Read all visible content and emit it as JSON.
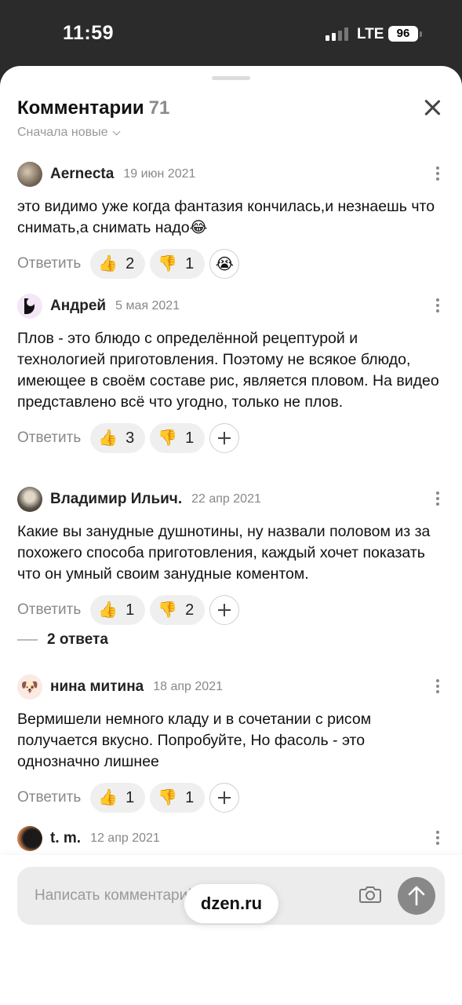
{
  "status_bar": {
    "time": "11:59",
    "network": "LTE",
    "battery": "96"
  },
  "header": {
    "title": "Комментарии",
    "count": "71",
    "sort_label": "Сначала новые"
  },
  "comments": [
    {
      "author": "Aernecta",
      "date": "19 июн 2021",
      "text": "это видимо уже когда фантазия кончилась,и незнаешь что снимать,а снимать надо😂",
      "reply_label": "Ответить",
      "likes": "2",
      "dislikes": "1",
      "extra_reaction": "😭"
    },
    {
      "author": "Андрей",
      "date": "5 мая 2021",
      "text": "Плов - это блюдо с определённой рецептурой и технологией приготовления. Поэтому не всякое блюдо, имеющее в своём составе рис, является пловом. На видео представлено всё что угодно, только не плов.",
      "reply_label": "Ответить",
      "likes": "3",
      "dislikes": "1"
    },
    {
      "author": "Владимир Ильич.",
      "date": "22 апр 2021",
      "text": "Какие вы занудные душнотины, ну назвали половом из за похожего способа приготовления, каждый хочет показать что он умный своим занудные коментом.",
      "reply_label": "Ответить",
      "likes": "1",
      "dislikes": "2"
    },
    {
      "author": "нина митина",
      "date": "18 апр 2021",
      "text": "Вермишели немного кладу и в сочетании с рисом получается вкусно. Попробуйте, Но фасоль - это однозначно лишнее",
      "reply_label": "Ответить",
      "likes": "1",
      "dislikes": "1"
    },
    {
      "author": "t. m.",
      "date": "12 апр 2021"
    }
  ],
  "replies_link": "2 ответа",
  "composer": {
    "placeholder": "Написать комментарий"
  },
  "url": "dzen.ru",
  "icons": {
    "like": "thumbs-up-icon",
    "dislike": "thumbs-down-icon",
    "add": "plus-icon",
    "camera": "camera-icon",
    "send": "arrow-up-icon"
  }
}
